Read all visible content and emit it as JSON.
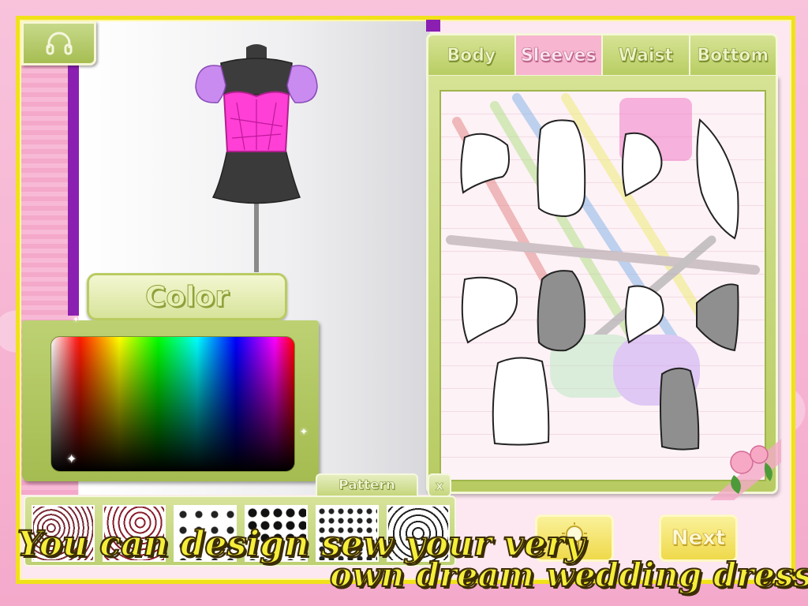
{
  "tabs": [
    {
      "label": "Body"
    },
    {
      "label": "Sleeves",
      "active": true
    },
    {
      "label": "Waist"
    },
    {
      "label": "Bottom"
    }
  ],
  "color_button_label": "Color",
  "pattern_tab_label": "Pattern",
  "pattern_close_label": "x",
  "next_button_label": "Next",
  "caption": {
    "line1": "You can design sew your very",
    "line2": "own dream wedding dress."
  },
  "icons": {
    "audio": "headphones-icon",
    "hint": "lightbulb-icon"
  },
  "colors": {
    "frame": "#f1e11a",
    "panel": "#bdd173",
    "active_tab": "#f7b5cf",
    "bodice": "#ff3fd6",
    "sleeve": "#c98bef"
  },
  "sleeve_options": [
    {
      "id": "sleeve-1",
      "fill": "white"
    },
    {
      "id": "sleeve-2",
      "fill": "white"
    },
    {
      "id": "sleeve-3",
      "fill": "white"
    },
    {
      "id": "sleeve-4",
      "fill": "white"
    },
    {
      "id": "sleeve-5",
      "fill": "white"
    },
    {
      "id": "sleeve-6",
      "fill": "gray"
    },
    {
      "id": "sleeve-7",
      "fill": "white"
    },
    {
      "id": "sleeve-8",
      "fill": "gray"
    },
    {
      "id": "sleeve-9",
      "fill": "white"
    },
    {
      "id": "sleeve-10",
      "fill": "gray"
    }
  ],
  "patterns": [
    {
      "id": "pattern-1"
    },
    {
      "id": "pattern-2"
    },
    {
      "id": "pattern-3"
    },
    {
      "id": "pattern-4"
    },
    {
      "id": "pattern-5"
    },
    {
      "id": "pattern-6"
    }
  ]
}
